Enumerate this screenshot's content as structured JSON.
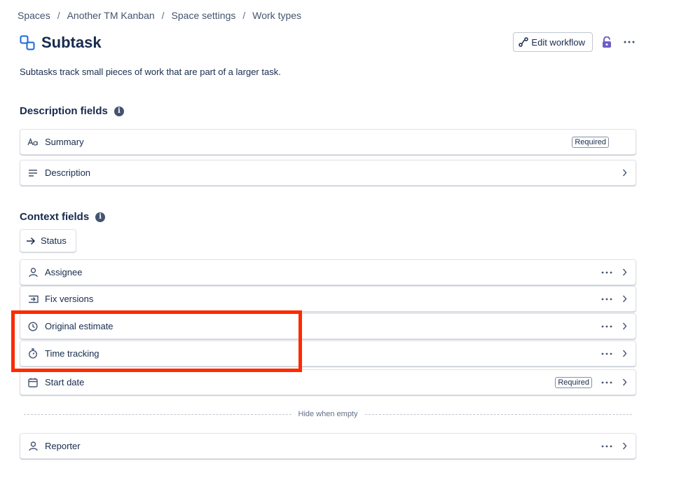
{
  "breadcrumb": [
    "Spaces",
    "Another TM Kanban",
    "Space settings",
    "Work types"
  ],
  "breadcrumb_separator": "/",
  "page": {
    "title": "Subtask",
    "description": "Subtasks track small pieces of work that are part of a larger task.",
    "edit_workflow_label": "Edit workflow"
  },
  "description_fields": {
    "title": "Description fields",
    "info_glyph": "i",
    "rows": [
      {
        "label": "Summary",
        "icon": "text-style-icon",
        "badge": "Required"
      },
      {
        "label": "Description",
        "icon": "text-lines-icon"
      }
    ]
  },
  "context_fields": {
    "title": "Context fields",
    "info_glyph": "i",
    "status_chip": "Status",
    "rows": [
      {
        "label": "Assignee",
        "icon": "person-icon"
      },
      {
        "label": "Fix versions",
        "icon": "ship-icon"
      },
      {
        "label": "Original estimate",
        "icon": "clock-icon"
      },
      {
        "label": "Time tracking",
        "icon": "stopwatch-icon"
      },
      {
        "label": "Start date",
        "icon": "calendar-icon",
        "badge": "Required"
      }
    ],
    "hide_when_empty_label": "Hide when empty",
    "hidden_rows": [
      {
        "label": "Reporter",
        "icon": "person-icon"
      }
    ]
  },
  "colors": {
    "accent": "#1868db",
    "lock": "#6e5dc6",
    "highlight": "#ff2a00"
  }
}
